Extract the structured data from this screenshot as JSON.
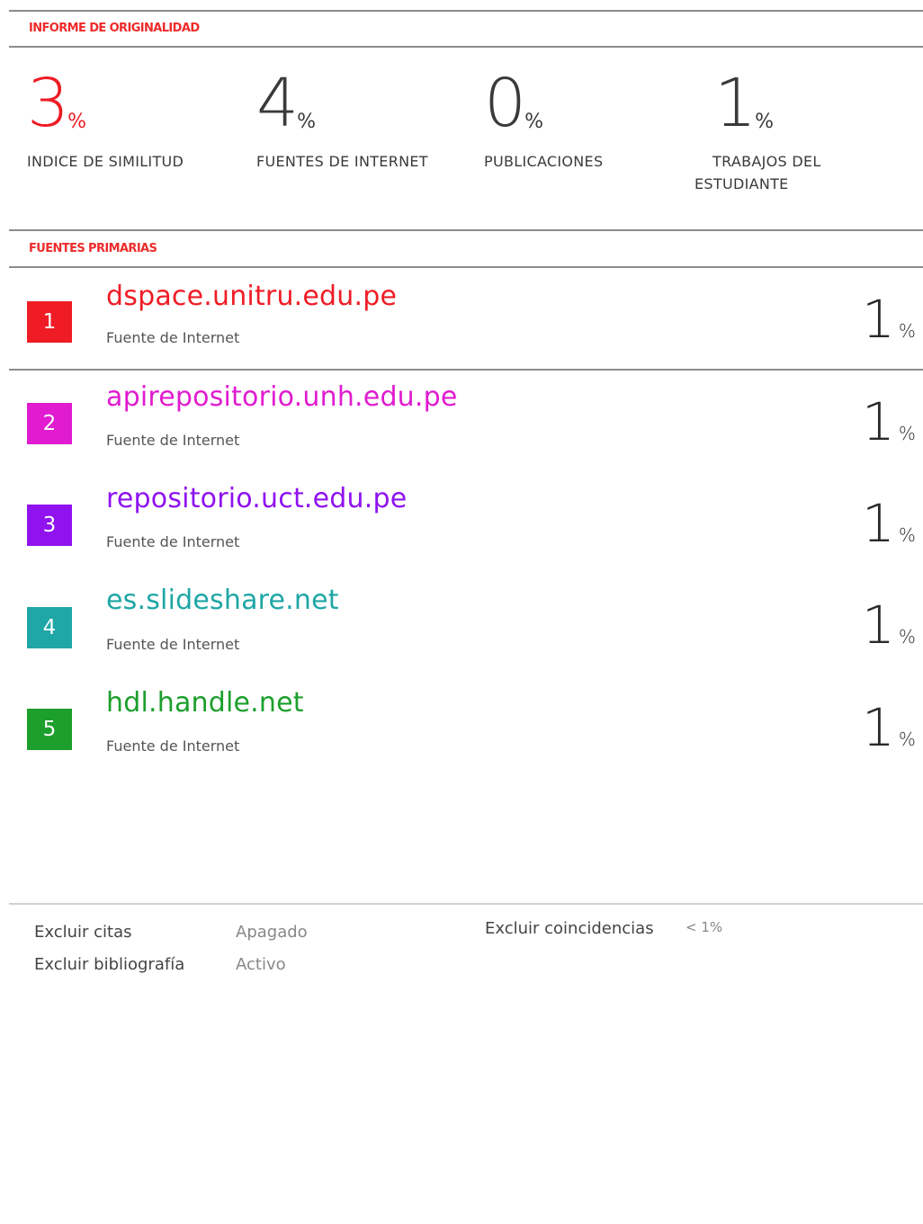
{
  "report": {
    "header_title": "INFORME DE ORIGINALIDAD",
    "stats": [
      {
        "value": "3",
        "unit": "%",
        "label": "INDICE DE SIMILITUD"
      },
      {
        "value": "4",
        "unit": "%",
        "label": "FUENTES DE INTERNET"
      },
      {
        "value": "0",
        "unit": "%",
        "label": "PUBLICACIONES"
      },
      {
        "value": "1",
        "unit": "%",
        "label_line1": "TRABAJOS DEL",
        "label_line2": "ESTUDIANTE"
      }
    ],
    "sources_title": "FUENTES PRIMARIAS",
    "sources": [
      {
        "rank": "1",
        "name": "dspace.unitru.edu.pe",
        "type": "Fuente de Internet",
        "value": "1",
        "unit": "%",
        "color": "#ef1c25"
      },
      {
        "rank": "2",
        "name": "apirepositorio.unh.edu.pe",
        "type": "Fuente de Internet",
        "value": "1",
        "unit": "%",
        "color": "#e01bd0"
      },
      {
        "rank": "3",
        "name": "repositorio.uct.edu.pe",
        "type": "Fuente de Internet",
        "value": "1",
        "unit": "%",
        "color": "#8f12ef"
      },
      {
        "rank": "4",
        "name": "es.slideshare.net",
        "type": "Fuente de Internet",
        "value": "1",
        "unit": "%",
        "color": "#1fa6a6"
      },
      {
        "rank": "5",
        "name": "hdl.handle.net",
        "type": "Fuente de Internet",
        "value": "1",
        "unit": "%",
        "color": "#1c9f2c"
      }
    ],
    "footer": {
      "exclude_quotes_label": "Excluir citas",
      "exclude_quotes_value": "Apagado",
      "exclude_bibliography_label": "Excluir bibliografía",
      "exclude_bibliography_value": "Activo",
      "exclude_matches_label": "Excluir coincidencias",
      "exclude_matches_value": "< 1%"
    }
  }
}
